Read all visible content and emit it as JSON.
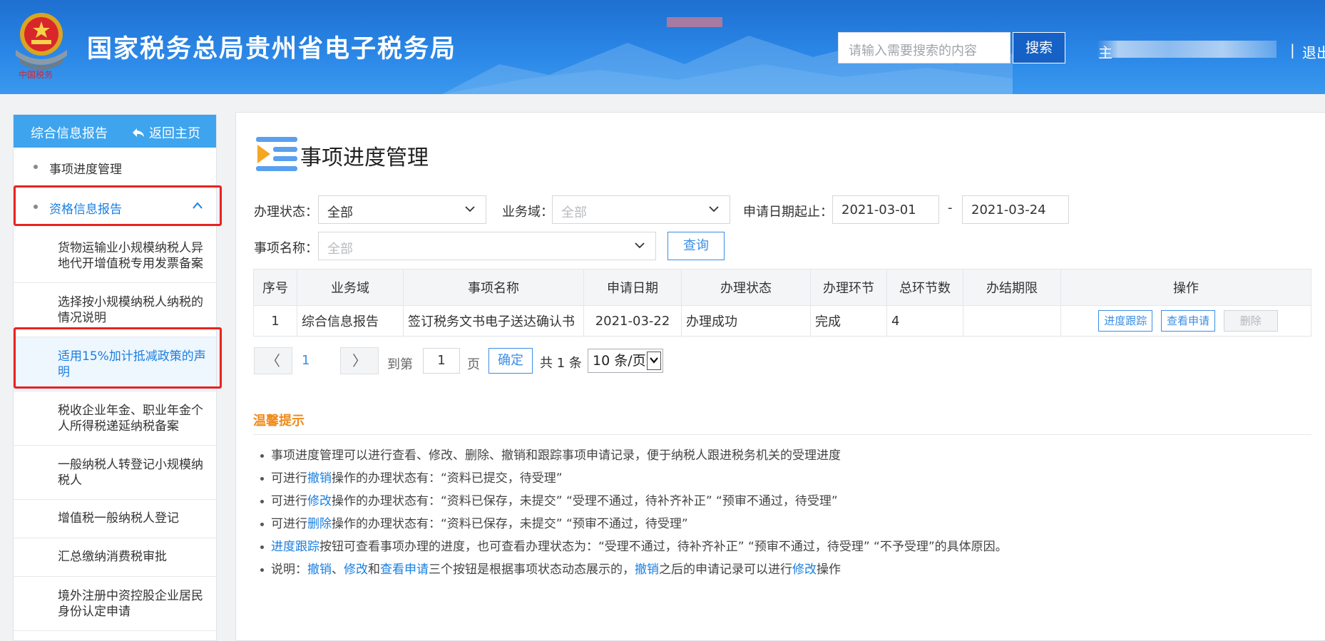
{
  "header": {
    "title": "国家税务总局贵州省电子税务局",
    "emblem_caption": "中国税务",
    "search_placeholder": "请输入需要搜索的内容",
    "search_button": "搜索",
    "user_initial": "主",
    "separator": "|",
    "logout": "退出"
  },
  "sidebar": {
    "header_title": "综合信息报告",
    "back_label": "返回主页",
    "items": [
      {
        "label": "事项进度管理"
      },
      {
        "label": "资格信息报告"
      }
    ],
    "sub_items": [
      {
        "label": "货物运输业小规模纳税人异地代开增值税专用发票备案"
      },
      {
        "label": "选择按小规模纳税人纳税的情况说明"
      },
      {
        "label": "适用15%加计抵减政策的声明"
      },
      {
        "label": "税收企业年金、职业年金个人所得税递延纳税备案"
      },
      {
        "label": "一般纳税人转登记小规模纳税人"
      },
      {
        "label": "增值税一般纳税人登记"
      },
      {
        "label": "汇总缴纳消费税审批"
      },
      {
        "label": "境外注册中资控股企业居民身份认定申请"
      }
    ]
  },
  "main": {
    "title": "事项进度管理",
    "filters": {
      "status_label": "办理状态：",
      "status_value": "全部",
      "domain_label": "业务域：",
      "domain_value": "全部",
      "date_label": "申请日期起止：",
      "date_from": "2021-03-01",
      "date_dash": "-",
      "date_to": "2021-03-24",
      "name_label": "事项名称：",
      "name_value": "全部",
      "query_button": "查询"
    },
    "table": {
      "headers": [
        "序号",
        "业务域",
        "事项名称",
        "申请日期",
        "办理状态",
        "办理环节",
        "总环节数",
        "办结期限",
        "操作"
      ],
      "rows": [
        {
          "no": "1",
          "domain": "综合信息报告",
          "name": "签订税务文书电子送达确认书",
          "date": "2021-03-22",
          "status": "办理成功",
          "stage": "完成",
          "total": "4",
          "deadline": ""
        }
      ],
      "ops": {
        "track": "进度跟踪",
        "view": "查看申请",
        "delete": "删除"
      }
    },
    "pager": {
      "prev": "〈",
      "current": "1",
      "next": "〉",
      "goto_label": "到第",
      "goto_value": "1",
      "page_unit": "页",
      "confirm": "确定",
      "total": "共 1 条",
      "page_size": "10 条/页"
    },
    "tips": {
      "title": "温馨提示",
      "lines": {
        "l1": "事项进度管理可以进行查看、修改、删除、撤销和跟踪事项申请记录，便于纳税人跟进税务机关的受理进度",
        "l2a": "可进行",
        "l2b": "撤销",
        "l2c": "操作的办理状态有：“资料已提交，待受理”",
        "l3a": "可进行",
        "l3b": "修改",
        "l3c": "操作的办理状态有：“资料已保存，未提交”  “受理不通过，待补齐补正”  “预审不通过，待受理”",
        "l4a": "可进行",
        "l4b": "删除",
        "l4c": "操作的办理状态有：“资料已保存，未提交”  “预审不通过，待受理”",
        "l5a": "进度跟踪",
        "l5b": "按钮可查看事项办理的进度，也可查看办理状态为：“受理不通过，待补齐补正”  “预审不通过，待受理”  “不予受理”的具体原因。",
        "l6a": "说明：",
        "l6b": "撤销",
        "l6c": "、",
        "l6d": "修改",
        "l6e": "和",
        "l6f": "查看申请",
        "l6g": "三个按钮是根据事项状态动态展示的，",
        "l6h": "撤销",
        "l6i": "之后的申请记录可以进行",
        "l6j": "修改",
        "l6k": "操作"
      }
    }
  },
  "colors": {
    "header_blue": "#2a86e6",
    "sidebar_header": "#3ea4ee",
    "link_blue": "#1a7fe0",
    "tips_orange": "#f08a1a",
    "highlight_red": "#e8231f"
  }
}
